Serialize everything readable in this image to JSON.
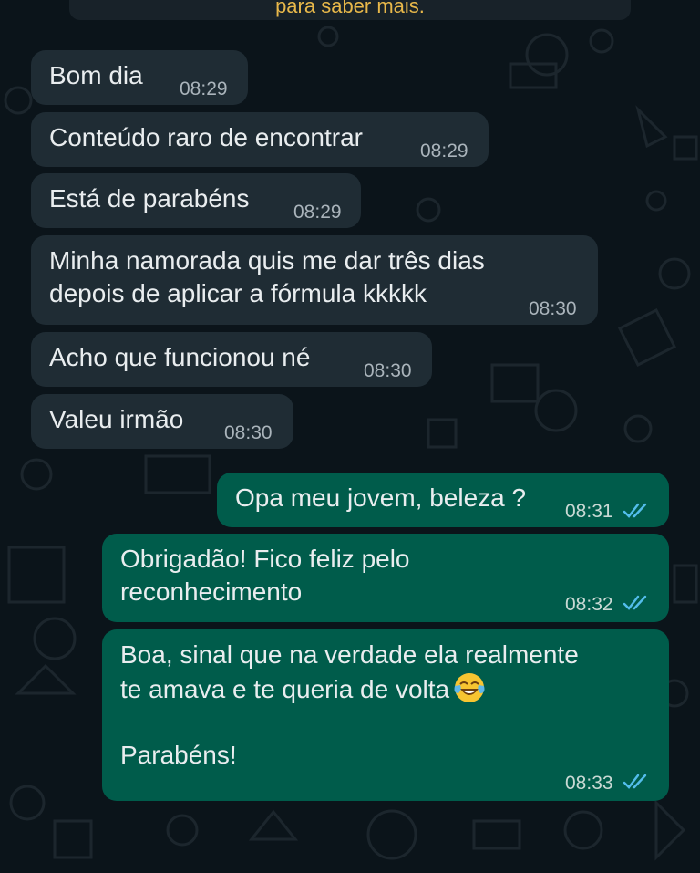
{
  "banner": {
    "text": "para saber mais."
  },
  "messages": [
    {
      "direction": "incoming",
      "text": "Bom dia",
      "time": "08:29"
    },
    {
      "direction": "incoming",
      "text": "Conteúdo raro de encontrar",
      "time": "08:29"
    },
    {
      "direction": "incoming",
      "text": "Está de parabéns",
      "time": "08:29"
    },
    {
      "direction": "incoming",
      "text": "Minha namorada quis me dar três dias\ndepois de aplicar a fórmula kkkkk",
      "time": "08:30"
    },
    {
      "direction": "incoming",
      "text": "Acho que funcionou né",
      "time": "08:30"
    },
    {
      "direction": "incoming",
      "text": "Valeu irmão",
      "time": "08:30"
    },
    {
      "direction": "outgoing",
      "text": "Opa meu jovem, beleza ?",
      "time": "08:31",
      "status": "read"
    },
    {
      "direction": "outgoing",
      "text": "Obrigadão! Fico feliz pelo\nreconhecimento",
      "time": "08:32",
      "status": "read"
    },
    {
      "direction": "outgoing",
      "text": "Boa, sinal que na verdade ela realmente\nte amava e te queria de volta",
      "text_emoji": "face-with-tears-of-joy",
      "text_after": "\n\nParabéns!",
      "time": "08:33",
      "status": "read"
    }
  ],
  "colors": {
    "background": "#0b141a",
    "incoming_bubble": "#1f2c34",
    "outgoing_bubble": "#005c4b",
    "read_ticks": "#53bdeb",
    "banner_text": "#e8b84a"
  }
}
